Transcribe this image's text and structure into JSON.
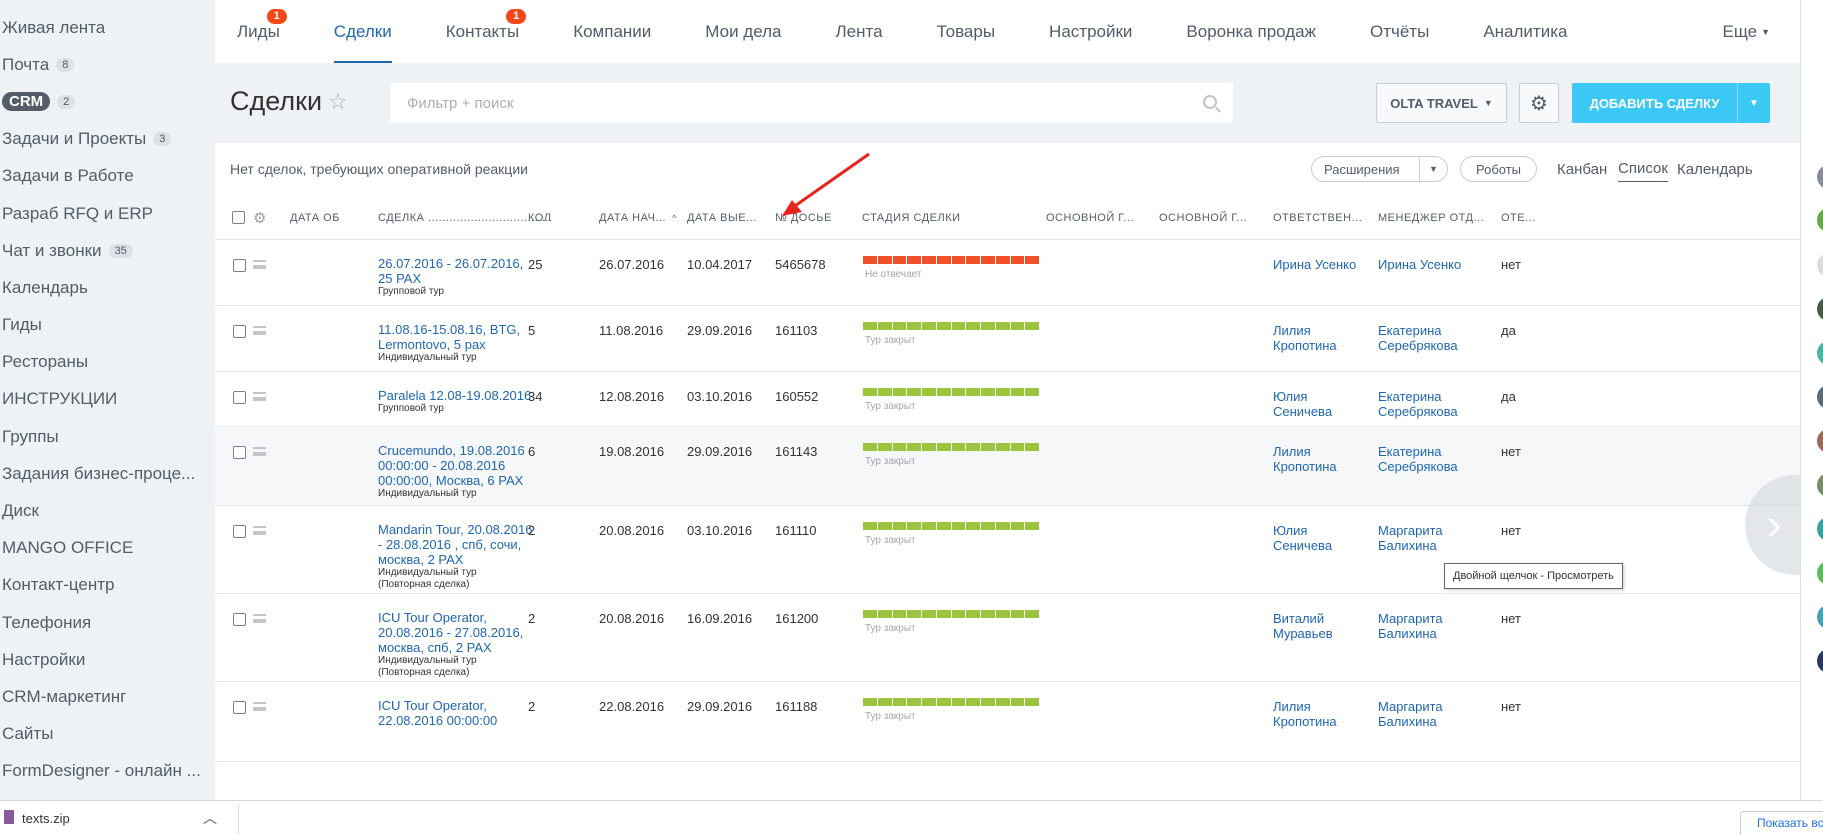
{
  "sidebar": {
    "items": [
      {
        "label": "Живая лента",
        "badge": ""
      },
      {
        "label": "Почта",
        "badge": "8"
      },
      {
        "label": "CRM",
        "badge": "2",
        "active": true
      },
      {
        "label": "Задачи и Проекты",
        "badge": "3"
      },
      {
        "label": "Задачи в Работе",
        "badge": ""
      },
      {
        "label": "Разраб RFQ и ERP",
        "badge": ""
      },
      {
        "label": "Чат и звонки",
        "badge": "35"
      },
      {
        "label": "Календарь",
        "badge": ""
      },
      {
        "label": "Гиды",
        "badge": ""
      },
      {
        "label": "Рестораны",
        "badge": ""
      },
      {
        "label": "ИНСТРУКЦИИ",
        "badge": ""
      },
      {
        "label": "Группы",
        "badge": ""
      },
      {
        "label": "Задания бизнес-проце...",
        "badge": ""
      },
      {
        "label": "Диск",
        "badge": ""
      },
      {
        "label": "MANGO OFFICE",
        "badge": ""
      },
      {
        "label": "Контакт-центр",
        "badge": ""
      },
      {
        "label": "Телефония",
        "badge": ""
      },
      {
        "label": "Настройки",
        "badge": ""
      },
      {
        "label": "CRM-маркетинг",
        "badge": ""
      },
      {
        "label": "Сайты",
        "badge": ""
      },
      {
        "label": "FormDesigner - онлайн ...",
        "badge": ""
      }
    ]
  },
  "topnav": {
    "items": [
      {
        "label": "Лиды",
        "badge": "1"
      },
      {
        "label": "Сделки",
        "badge": "",
        "active": true
      },
      {
        "label": "Контакты",
        "badge": "1"
      },
      {
        "label": "Компании",
        "badge": ""
      },
      {
        "label": "Мои дела",
        "badge": ""
      },
      {
        "label": "Лента",
        "badge": ""
      },
      {
        "label": "Товары",
        "badge": ""
      },
      {
        "label": "Настройки",
        "badge": ""
      },
      {
        "label": "Воронка продаж",
        "badge": ""
      },
      {
        "label": "Отчёты",
        "badge": ""
      },
      {
        "label": "Аналитика",
        "badge": ""
      }
    ],
    "more_label": "Еще"
  },
  "header": {
    "title": "Сделки",
    "filter_placeholder": "Фильтр + поиск",
    "company_label": "OLTA TRAVEL",
    "add_label": "ДОБАВИТЬ СДЕЛКУ"
  },
  "toolbar": {
    "info_text": "Нет сделок, требующих оперативной реакции",
    "extensions_label": "Расширения",
    "robots_label": "Роботы",
    "views": [
      "Канбан",
      "Список",
      "Календарь"
    ]
  },
  "table": {
    "columns": [
      "ДАТА ОБ",
      "СДЕЛКА ...................................",
      "КОЛ",
      "ДАТА НАЧ...",
      "ДАТА ВЫЕ...",
      "№ ДОСЬЕ",
      "СТАДИЯ СДЕЛКИ",
      "ОСНОВНОЙ Г...",
      "ОСНОВНОЙ Г...",
      "ОТВЕТСТВЕН...",
      "МЕНЕДЖЕР ОТД...",
      "ОТЕ..."
    ],
    "rows": [
      {
        "title": "26.07.2016 - 26.07.2016, 25 PAX",
        "type": "Групповой тур",
        "extra": "",
        "qty": "25",
        "start": "26.07.2016",
        "end": "10.04.2017",
        "dossier": "5465678",
        "stage": "Не отвечает",
        "stage_color": "#f0512a",
        "resp": "Ирина Усенко",
        "manager": "Ирина Усенко",
        "ote": "нет"
      },
      {
        "title": "11.08.16-15.08.16, BTG, Lermontovo, 5 pax",
        "type": "Индивидуальный тур",
        "extra": "",
        "qty": "5",
        "start": "11.08.2016",
        "end": "29.09.2016",
        "dossier": "161103",
        "stage": "Тур закрыт",
        "stage_color": "#9bc53d",
        "resp": "Лилия Кропотина",
        "manager": "Екатерина Серебрякова",
        "ote": "да"
      },
      {
        "title": "Paralela 12.08-19.08.2016",
        "type": "Групповой тур",
        "extra": "",
        "qty": "34",
        "start": "12.08.2016",
        "end": "03.10.2016",
        "dossier": "160552",
        "stage": "Тур закрыт",
        "stage_color": "#9bc53d",
        "resp": "Юлия Сеничева",
        "manager": "Екатерина Серебрякова",
        "ote": "да"
      },
      {
        "title": "Crucemundo, 19.08.2016 00:00:00 - 20.08.2016 00:00:00, Москва, 6 PAX",
        "type": "Индивидуальный тур",
        "extra": "",
        "qty": "6",
        "start": "19.08.2016",
        "end": "29.09.2016",
        "dossier": "161143",
        "stage": "Тур закрыт",
        "stage_color": "#9bc53d",
        "resp": "Лилия Кропотина",
        "manager": "Екатерина Серебрякова",
        "ote": "нет"
      },
      {
        "title": "Mandarin Tour, 20.08.2016 - 28.08.2016 , спб, сочи, москва, 2 PAX",
        "type": "Индивидуальный тур",
        "extra": "(Повторная сделка)",
        "qty": "2",
        "start": "20.08.2016",
        "end": "03.10.2016",
        "dossier": "161110",
        "stage": "Тур закрыт",
        "stage_color": "#9bc53d",
        "resp": "Юлия Сеничева",
        "manager": "Маргарита Балихина",
        "ote": "нет"
      },
      {
        "title": "ICU Tour Operator, 20.08.2016 - 27.08.2016, москва, спб, 2 PAX",
        "type": "Индивидуальный тур",
        "extra": "(Повторная сделка)",
        "qty": "2",
        "start": "20.08.2016",
        "end": "16.09.2016",
        "dossier": "161200",
        "stage": "Тур закрыт",
        "stage_color": "#9bc53d",
        "resp": "Виталий Муравьев",
        "manager": "Маргарита Балихина",
        "ote": "нет"
      },
      {
        "title": "ICU Tour Operator, 22.08.2016 00:00:00",
        "type": "",
        "extra": "",
        "qty": "2",
        "start": "22.08.2016",
        "end": "29.09.2016",
        "dossier": "161188",
        "stage": "Тур закрыт",
        "stage_color": "#9bc53d",
        "resp": "Лилия Кропотина",
        "manager": "Маргарита Балихина",
        "ote": "нет"
      }
    ]
  },
  "tooltip": "Двойной щелчок - Просмотреть",
  "download": {
    "file": "texts.zip",
    "show_all": "Показать все"
  },
  "colors": {
    "accent": "#2067b0",
    "add_button": "#3bc8f5",
    "badge": "#f54819",
    "annotation_arrow": "#e8231c"
  }
}
